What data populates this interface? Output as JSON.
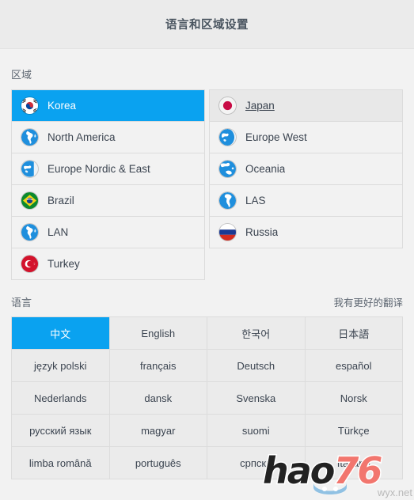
{
  "window": {
    "title": "语言和区域设置"
  },
  "region_section": {
    "label": "区域",
    "columns": [
      {
        "items": [
          {
            "name": "Korea",
            "icon": "flag-korea-icon",
            "state": "selected"
          },
          {
            "name": "North America",
            "icon": "globe-americas-icon",
            "state": "normal"
          },
          {
            "name": "Europe Nordic & East",
            "icon": "globe-europe-icon",
            "state": "normal"
          },
          {
            "name": "Brazil",
            "icon": "flag-brazil-icon",
            "state": "normal"
          },
          {
            "name": "LAN",
            "icon": "globe-americas-icon",
            "state": "normal"
          },
          {
            "name": "Turkey",
            "icon": "flag-turkey-icon",
            "state": "normal"
          }
        ]
      },
      {
        "items": [
          {
            "name": "Japan",
            "icon": "flag-japan-icon",
            "state": "hovered"
          },
          {
            "name": "Europe West",
            "icon": "globe-europe-west-icon",
            "state": "normal"
          },
          {
            "name": "Oceania",
            "icon": "globe-oceania-icon",
            "state": "normal"
          },
          {
            "name": "LAS",
            "icon": "globe-south-america-icon",
            "state": "normal"
          },
          {
            "name": "Russia",
            "icon": "flag-russia-icon",
            "state": "normal"
          }
        ]
      }
    ]
  },
  "language_section": {
    "label": "语言",
    "better_translation_link": "我有更好的翻译",
    "items": [
      {
        "name": "中文",
        "state": "selected"
      },
      {
        "name": "English",
        "state": "normal"
      },
      {
        "name": "한국어",
        "state": "normal"
      },
      {
        "name": "日本語",
        "state": "normal"
      },
      {
        "name": "język polski",
        "state": "normal"
      },
      {
        "name": "français",
        "state": "normal"
      },
      {
        "name": "Deutsch",
        "state": "normal"
      },
      {
        "name": "español",
        "state": "normal"
      },
      {
        "name": "Nederlands",
        "state": "normal"
      },
      {
        "name": "dansk",
        "state": "normal"
      },
      {
        "name": "Svenska",
        "state": "normal"
      },
      {
        "name": "Norsk",
        "state": "normal"
      },
      {
        "name": "русский язык",
        "state": "normal"
      },
      {
        "name": "magyar",
        "state": "normal"
      },
      {
        "name": "suomi",
        "state": "normal"
      },
      {
        "name": "Türkçe",
        "state": "normal"
      },
      {
        "name": "limba română",
        "state": "normal"
      },
      {
        "name": "português",
        "state": "normal"
      },
      {
        "name": "српски",
        "state": "normal"
      },
      {
        "name": "Italiano",
        "state": "normal"
      }
    ]
  },
  "watermark": {
    "brand_dark": "hao",
    "brand_accent": "76",
    "subtext": "wyx.net"
  },
  "colors": {
    "accent_blue": "#0aa2f0",
    "header_bg": "#ebebeb",
    "page_bg": "#f2f2f2",
    "cell_bg": "#ebebeb",
    "border": "#dcdcdc",
    "text": "#3b4450",
    "title_text": "#4a5560"
  }
}
